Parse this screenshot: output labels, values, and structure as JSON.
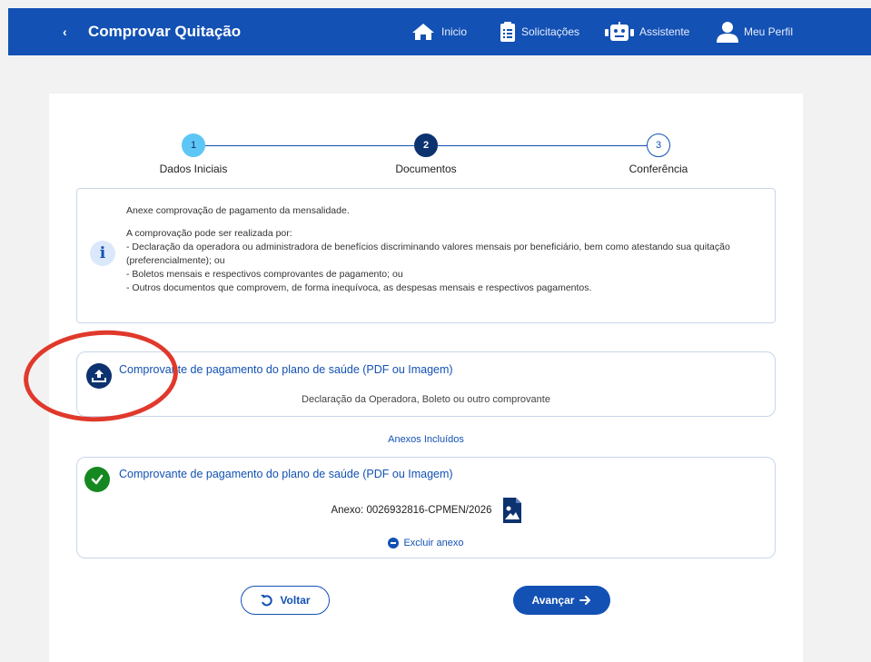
{
  "header": {
    "back_glyph": "‹",
    "title": "Comprovar Quitação",
    "nav": [
      {
        "label": "Inicio",
        "icon": "home-icon"
      },
      {
        "label": "Solicitações",
        "icon": "clipboard-icon"
      },
      {
        "label": "Assistente",
        "icon": "robot-icon"
      },
      {
        "label": "Meu Perfil",
        "icon": "user-icon"
      }
    ]
  },
  "stepper": {
    "current_step": 2,
    "steps": [
      {
        "number": "1",
        "label": "Dados Iniciais"
      },
      {
        "number": "2",
        "label": "Documentos"
      },
      {
        "number": "3",
        "label": "Conferência"
      }
    ]
  },
  "info": {
    "icon": "info-icon",
    "lines_first": "Anexe comprovação de pagamento da mensalidade.",
    "intro": "A comprovação pode ser realizada por:",
    "item1": "- Declaração da operadora ou administradora de benefícios discriminando valores mensais por beneficiário, bem como atestando sua quitação (preferencialmente); ou",
    "item2": "- Boletos mensais e respectivos comprovantes de pagamento; ou",
    "item3": "- Outros documentos que comprovem, de forma inequívoca, as despesas mensais e respectivos pagamentos."
  },
  "upload": {
    "icon": "upload-icon",
    "title": "Comprovante de pagamento do plano de saúde (PDF ou Imagem)",
    "subtitle": "Declaração da Operadora, Boleto ou outro comprovante"
  },
  "annexes": {
    "heading": "Anexos Incluídos",
    "items": [
      {
        "icon": "check-icon",
        "title": "Comprovante de pagamento do plano de saúde (PDF ou Imagem)",
        "file_label": "Anexo: 0026932816-CPMEN/2026",
        "file_icon": "image-file-icon",
        "remove_label": "Excluir anexo"
      }
    ]
  },
  "actions": {
    "back_label": "Voltar",
    "next_label": "Avançar"
  },
  "colors": {
    "primary": "#1351b4",
    "dark": "#0c326f",
    "success": "#168821",
    "step_done": "#5ec6f5",
    "annotation": "#e0392c"
  }
}
